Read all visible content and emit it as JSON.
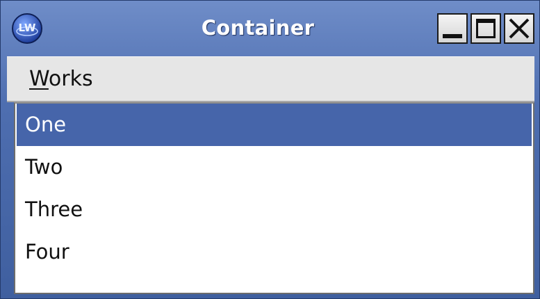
{
  "window": {
    "title": "Container",
    "logo_text": "LW"
  },
  "menubar": {
    "items": [
      {
        "mnemonic": "W",
        "rest": "orks"
      }
    ]
  },
  "list": {
    "items": [
      "One",
      "Two",
      "Three",
      "Four"
    ],
    "selected": "One"
  },
  "colors": {
    "titlebar": "#4e6eb0",
    "selection": "#4665aa",
    "menubar": "#e6e6e6"
  }
}
